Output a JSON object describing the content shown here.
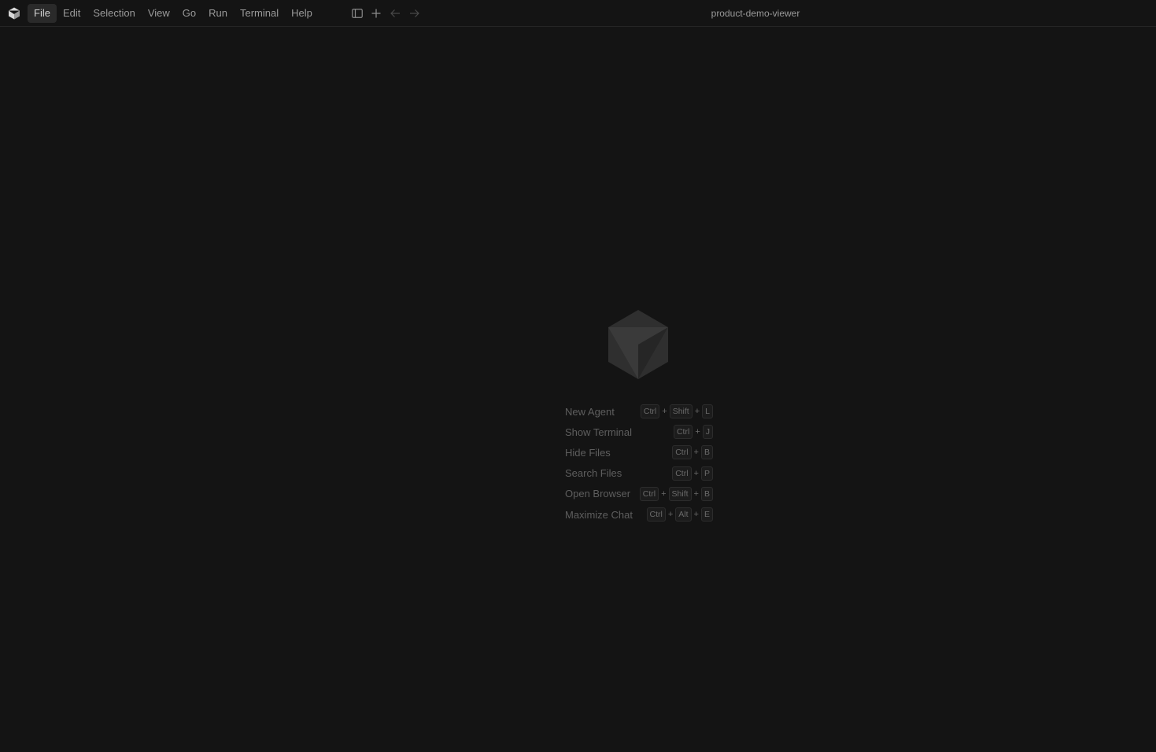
{
  "titlebar": {
    "window_title": "product-demo-viewer",
    "menu": [
      {
        "label": "File",
        "active": true
      },
      {
        "label": "Edit"
      },
      {
        "label": "Selection"
      },
      {
        "label": "View"
      },
      {
        "label": "Go"
      },
      {
        "label": "Run"
      },
      {
        "label": "Terminal"
      },
      {
        "label": "Help"
      }
    ],
    "toolbar_icons": [
      "sidebar-toggle-icon",
      "plus-icon",
      "arrow-left-icon",
      "arrow-right-icon"
    ]
  },
  "welcome": {
    "logo_icon": "cube-logo-icon",
    "shortcuts": [
      {
        "label": "New Agent",
        "keys": [
          "Ctrl",
          "Shift",
          "L"
        ]
      },
      {
        "label": "Show Terminal",
        "keys": [
          "Ctrl",
          "J"
        ]
      },
      {
        "label": "Hide Files",
        "keys": [
          "Ctrl",
          "B"
        ]
      },
      {
        "label": "Search Files",
        "keys": [
          "Ctrl",
          "P"
        ]
      },
      {
        "label": "Open Browser",
        "keys": [
          "Ctrl",
          "Shift",
          "B"
        ]
      },
      {
        "label": "Maximize Chat",
        "keys": [
          "Ctrl",
          "Alt",
          "E"
        ]
      }
    ]
  },
  "colors": {
    "background": "#141414",
    "menu_active_bg": "#2a2a2a",
    "logo": "#2f2f2f"
  }
}
